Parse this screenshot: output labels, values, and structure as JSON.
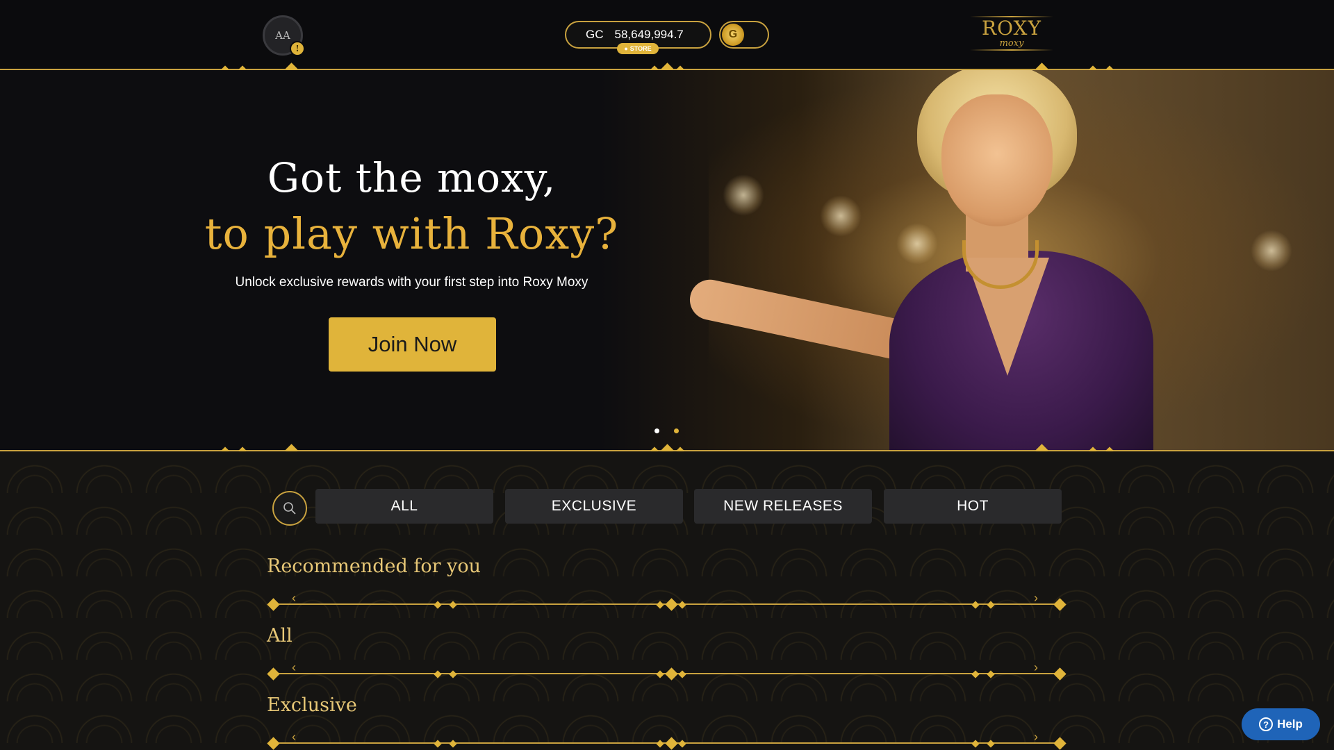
{
  "header": {
    "avatar_initials": "AA",
    "avatar_badge": "!",
    "balance_currency": "GC",
    "balance_amount": "58,649,994.7",
    "store_label": "STORE",
    "logo_main": "ROXY",
    "logo_sub": "moxy"
  },
  "hero": {
    "title_line1": "Got the moxy,",
    "title_line2": "to play with Roxy?",
    "subtitle": "Unlock exclusive rewards with your first step into Roxy Moxy",
    "cta_label": "Join Now",
    "carousel_active_index": 0,
    "carousel_count": 2
  },
  "filters": {
    "tabs": [
      {
        "label": "ALL"
      },
      {
        "label": "EXCLUSIVE"
      },
      {
        "label": "NEW RELEASES"
      },
      {
        "label": "HOT"
      }
    ]
  },
  "sections": [
    {
      "title": "Recommended for you"
    },
    {
      "title": "All"
    },
    {
      "title": "Exclusive"
    }
  ],
  "help": {
    "label": "Help"
  },
  "colors": {
    "gold": "#c9a23f",
    "gold_bright": "#e0b43a",
    "background": "#0b0b0d",
    "help_blue": "#1f64b8"
  },
  "icons": [
    "search-icon",
    "coin-icon",
    "help-icon",
    "chevron-left-icon",
    "chevron-right-icon"
  ]
}
